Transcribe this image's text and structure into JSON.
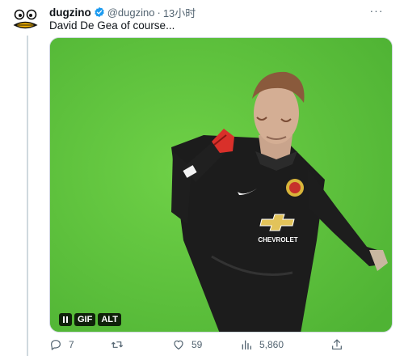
{
  "tweet": {
    "display_name": "dugzino",
    "handle": "@dugzino",
    "separator": "·",
    "time": "13小时",
    "more_label": "···",
    "text": "David De Gea of course..."
  },
  "media": {
    "gif_label": "GIF",
    "alt_label": "ALT",
    "jersey_brand": "CHEVROLET"
  },
  "actions": {
    "reply_count": "7",
    "retweet_count": "",
    "like_count": "59",
    "views_count": "5,860"
  },
  "colors": {
    "verified": "#1d9bf0",
    "pitch": "#5ec33d",
    "text_secondary": "#536471"
  }
}
